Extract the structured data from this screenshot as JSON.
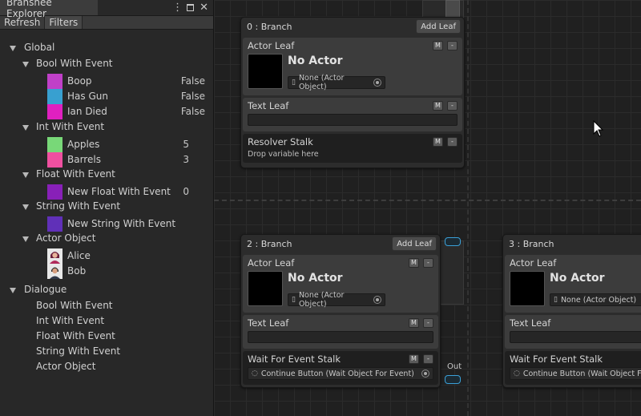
{
  "explorer": {
    "title": "Branshee Explorer",
    "toolbar": {
      "refresh": "Refresh",
      "filters": "Filters"
    },
    "global_label": "Global",
    "groups": {
      "bool": {
        "label": "Bool With Event",
        "items": [
          {
            "name": "Boop",
            "value": "False",
            "color": "#c040c8"
          },
          {
            "name": "Has Gun",
            "value": "False",
            "color": "#38a0d0"
          },
          {
            "name": "Ian Died",
            "value": "False",
            "color": "#e020c0"
          }
        ]
      },
      "int": {
        "label": "Int With Event",
        "items": [
          {
            "name": "Apples",
            "value": "5",
            "color": "#78d878"
          },
          {
            "name": "Barrels",
            "value": "3",
            "color": "#f050a0"
          }
        ]
      },
      "float": {
        "label": "Float With Event",
        "items": [
          {
            "name": "New Float With Event",
            "value": "0",
            "color": "#8820b8"
          }
        ]
      },
      "string": {
        "label": "String With Event",
        "items": [
          {
            "name": "New String With Event",
            "color": "#6030b8"
          }
        ]
      },
      "actor": {
        "label": "Actor Object",
        "items": [
          {
            "name": "Alice"
          },
          {
            "name": "Bob"
          }
        ]
      }
    },
    "dialogue_label": "Dialogue",
    "dialogue_items": [
      "Bool With Event",
      "Int With Event",
      "Float With Event",
      "String With Event",
      "Actor Object"
    ]
  },
  "graph": {
    "nodes": [
      {
        "title": "0 : Branch",
        "add_leaf": "Add Leaf",
        "actor_leaf": "Actor Leaf",
        "no_actor": "No Actor",
        "actor_field": "None (Actor Object)",
        "text_leaf": "Text Leaf",
        "stalk_title": "Resolver Stalk",
        "stalk_hint": "Drop variable here"
      },
      {
        "title": "2 : Branch",
        "add_leaf": "Add Leaf",
        "actor_leaf": "Actor Leaf",
        "no_actor": "No Actor",
        "actor_field": "None (Actor Object)",
        "text_leaf": "Text Leaf",
        "stalk_title": "Wait For Event Stalk",
        "stalk_field": "Continue Button (Wait Object For Event)",
        "out_label": "Out"
      },
      {
        "title": "3 : Branch",
        "actor_leaf": "Actor Leaf",
        "no_actor": "No Actor",
        "actor_field": "None (Actor Object)",
        "text_leaf": "Text Leaf",
        "stalk_title": "Wait For Event Stalk",
        "stalk_field": "Continue Button (Wait Object For Event)"
      }
    ],
    "btn_m": "M",
    "btn_minus": "-"
  }
}
